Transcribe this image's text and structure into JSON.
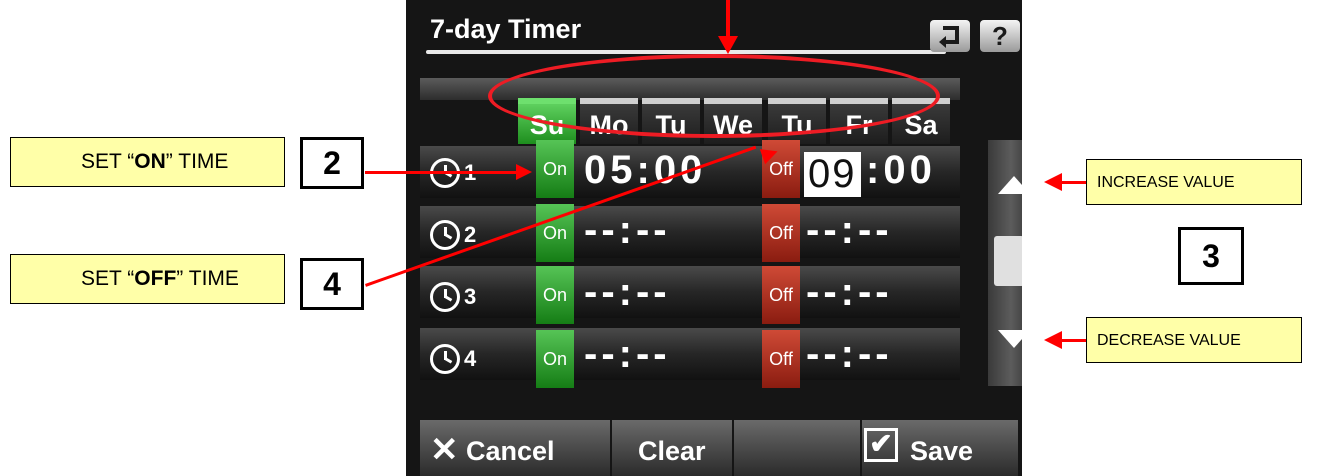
{
  "device": {
    "title": "7-day Timer",
    "back_icon": "back-arrow-icon",
    "help_label": "?",
    "days": [
      "Su",
      "Mo",
      "Tu",
      "We",
      "Tu",
      "Fr",
      "Sa"
    ],
    "active_day": "Su",
    "rows": [
      {
        "num": "1",
        "on_label": "On",
        "on_time": "05:00",
        "off_label": "Off",
        "off_hour": "09",
        "off_min": ":00"
      },
      {
        "num": "2",
        "on_label": "On",
        "on_time": "--:--",
        "off_label": "Off",
        "off_time": "--:--"
      },
      {
        "num": "3",
        "on_label": "On",
        "on_time": "--:--",
        "off_label": "Off",
        "off_time": "--:--"
      },
      {
        "num": "4",
        "on_label": "On",
        "on_time": "--:--",
        "off_label": "Off",
        "off_time": "--:--"
      }
    ],
    "footer": {
      "cancel": "Cancel",
      "clear": "Clear",
      "save": "Save"
    },
    "colors": {
      "on": "#2ea82e",
      "off": "#b93322",
      "screen": "#151515"
    }
  },
  "annotations": {
    "set_on": {
      "prefix": "SET “",
      "bold": "ON",
      "suffix": "” TIME",
      "number": "2"
    },
    "set_off": {
      "prefix": "SET “",
      "bold": "OFF",
      "suffix": "” TIME",
      "number": "4"
    },
    "increase": "INCREASE VALUE",
    "decrease": "DECREASE VALUE",
    "number_3": "3",
    "colors": {
      "callout_bg": "#ffffa8",
      "arrow": "#ff0000"
    }
  }
}
